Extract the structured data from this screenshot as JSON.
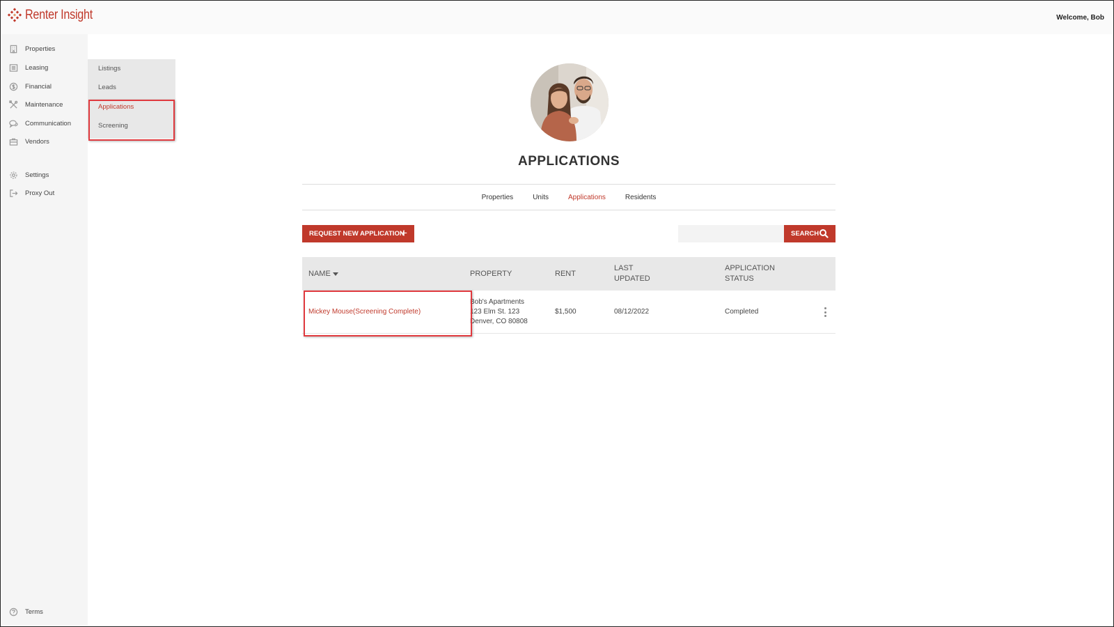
{
  "header": {
    "brand": "Renter Insight",
    "welcome": "Welcome, Bob",
    "brand_color": "#c0392b"
  },
  "sidebar": {
    "items": [
      {
        "label": "Properties",
        "icon": "building-icon"
      },
      {
        "label": "Leasing",
        "icon": "list-icon"
      },
      {
        "label": "Financial",
        "icon": "dollar-icon"
      },
      {
        "label": "Maintenance",
        "icon": "tools-icon"
      },
      {
        "label": "Communication",
        "icon": "chat-icon"
      },
      {
        "label": "Vendors",
        "icon": "briefcase-icon"
      },
      {
        "label": "Settings",
        "icon": "gear-icon"
      },
      {
        "label": "Proxy Out",
        "icon": "logout-icon"
      }
    ],
    "footer": {
      "label": "Terms",
      "icon": "question-icon"
    }
  },
  "submenu": {
    "items": [
      {
        "label": "Listings",
        "active": false
      },
      {
        "label": "Leads",
        "active": false
      },
      {
        "label": "Applications",
        "active": true
      },
      {
        "label": "Screening",
        "active": false
      }
    ]
  },
  "main": {
    "title": "APPLICATIONS",
    "tabs": [
      {
        "label": "Properties",
        "active": false
      },
      {
        "label": "Units",
        "active": false
      },
      {
        "label": "Applications",
        "active": true
      },
      {
        "label": "Residents",
        "active": false
      }
    ],
    "request_button": "REQUEST NEW APPLICATION",
    "search": {
      "value": "",
      "placeholder": "",
      "button": "SEARCH"
    },
    "table": {
      "columns": {
        "name": "NAME",
        "property": "PROPERTY",
        "rent": "RENT",
        "last_updated_1": "LAST",
        "last_updated_2": "UPDATED",
        "status_1": "APPLICATION",
        "status_2": "STATUS"
      },
      "rows": [
        {
          "name": "Mickey Mouse(Screening Complete)",
          "property_line1": "Bob's Apartments",
          "property_line2": "123 Elm St. 123",
          "property_line3": "Denver, CO 80808",
          "rent": "$1,500",
          "last_updated": "08/12/2022",
          "status": "Completed"
        }
      ]
    }
  }
}
